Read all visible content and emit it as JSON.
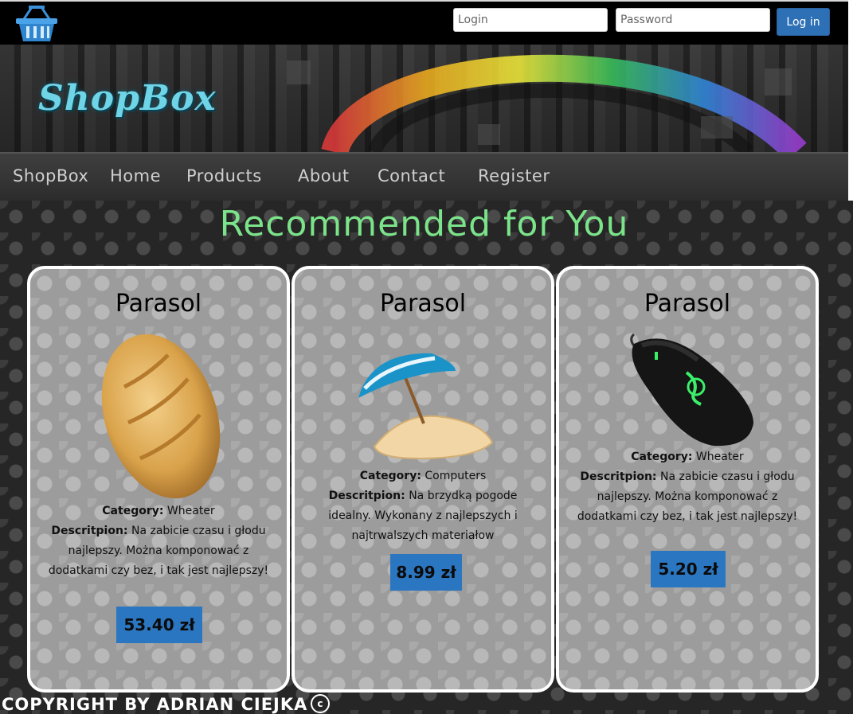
{
  "header": {
    "cart_icon": "shopping-basket-icon",
    "login_placeholder": "Login",
    "password_placeholder": "Password",
    "login_button": "Log in"
  },
  "banner": {
    "logo": "ShopBox"
  },
  "nav": {
    "items": [
      "ShopBox",
      "Home",
      "Products",
      "About",
      "Contact",
      "Register"
    ]
  },
  "main": {
    "title": "Recommended for You",
    "category_label": "Category:",
    "description_label": "Descritpion:",
    "products": [
      {
        "name": "Parasol",
        "image": "bread-loaf-image",
        "category": "Wheater",
        "description": "Na zabicie czasu i głodu najlepszy. Można komponować z dodatkami czy bez, i tak jest najlepszy!",
        "price": "53.40 zł"
      },
      {
        "name": "Parasol",
        "image": "beach-umbrella-image",
        "category": "Computers",
        "description": "Na brzydką pogode idealny. Wykonany z najlepszych i najtrwalszych materiałow",
        "price": "8.99 zł"
      },
      {
        "name": "Parasol",
        "image": "gaming-mouse-image",
        "category": "Wheater",
        "description": "Na zabicie czasu i głodu najlepszy. Można komponować z dodatkami czy bez, i tak jest najlepszy!",
        "price": "5.20 zł"
      }
    ]
  },
  "footer": {
    "text": "COPYRIGHT BY ADRIAN CIEJKA",
    "symbol": "c"
  },
  "colors": {
    "title_green": "#7be38a",
    "price_blue": "#2b76c0",
    "login_blue": "#2e70b6"
  }
}
